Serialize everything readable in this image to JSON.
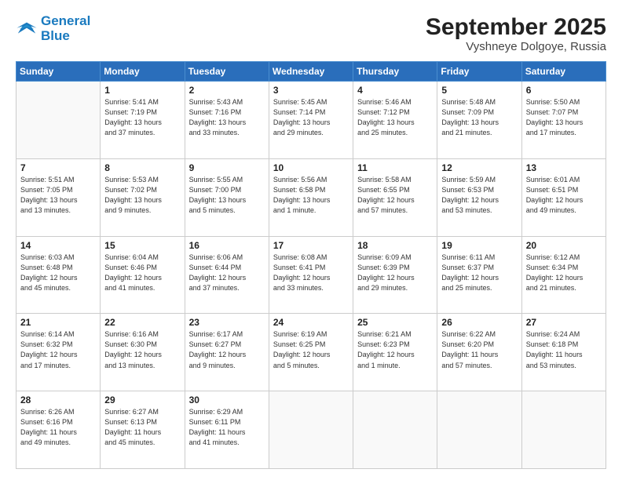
{
  "logo": {
    "line1": "General",
    "line2": "Blue"
  },
  "title": "September 2025",
  "location": "Vyshneye Dolgoye, Russia",
  "weekdays": [
    "Sunday",
    "Monday",
    "Tuesday",
    "Wednesday",
    "Thursday",
    "Friday",
    "Saturday"
  ],
  "weeks": [
    [
      {
        "day": "",
        "info": ""
      },
      {
        "day": "1",
        "info": "Sunrise: 5:41 AM\nSunset: 7:19 PM\nDaylight: 13 hours\nand 37 minutes."
      },
      {
        "day": "2",
        "info": "Sunrise: 5:43 AM\nSunset: 7:16 PM\nDaylight: 13 hours\nand 33 minutes."
      },
      {
        "day": "3",
        "info": "Sunrise: 5:45 AM\nSunset: 7:14 PM\nDaylight: 13 hours\nand 29 minutes."
      },
      {
        "day": "4",
        "info": "Sunrise: 5:46 AM\nSunset: 7:12 PM\nDaylight: 13 hours\nand 25 minutes."
      },
      {
        "day": "5",
        "info": "Sunrise: 5:48 AM\nSunset: 7:09 PM\nDaylight: 13 hours\nand 21 minutes."
      },
      {
        "day": "6",
        "info": "Sunrise: 5:50 AM\nSunset: 7:07 PM\nDaylight: 13 hours\nand 17 minutes."
      }
    ],
    [
      {
        "day": "7",
        "info": "Sunrise: 5:51 AM\nSunset: 7:05 PM\nDaylight: 13 hours\nand 13 minutes."
      },
      {
        "day": "8",
        "info": "Sunrise: 5:53 AM\nSunset: 7:02 PM\nDaylight: 13 hours\nand 9 minutes."
      },
      {
        "day": "9",
        "info": "Sunrise: 5:55 AM\nSunset: 7:00 PM\nDaylight: 13 hours\nand 5 minutes."
      },
      {
        "day": "10",
        "info": "Sunrise: 5:56 AM\nSunset: 6:58 PM\nDaylight: 13 hours\nand 1 minute."
      },
      {
        "day": "11",
        "info": "Sunrise: 5:58 AM\nSunset: 6:55 PM\nDaylight: 12 hours\nand 57 minutes."
      },
      {
        "day": "12",
        "info": "Sunrise: 5:59 AM\nSunset: 6:53 PM\nDaylight: 12 hours\nand 53 minutes."
      },
      {
        "day": "13",
        "info": "Sunrise: 6:01 AM\nSunset: 6:51 PM\nDaylight: 12 hours\nand 49 minutes."
      }
    ],
    [
      {
        "day": "14",
        "info": "Sunrise: 6:03 AM\nSunset: 6:48 PM\nDaylight: 12 hours\nand 45 minutes."
      },
      {
        "day": "15",
        "info": "Sunrise: 6:04 AM\nSunset: 6:46 PM\nDaylight: 12 hours\nand 41 minutes."
      },
      {
        "day": "16",
        "info": "Sunrise: 6:06 AM\nSunset: 6:44 PM\nDaylight: 12 hours\nand 37 minutes."
      },
      {
        "day": "17",
        "info": "Sunrise: 6:08 AM\nSunset: 6:41 PM\nDaylight: 12 hours\nand 33 minutes."
      },
      {
        "day": "18",
        "info": "Sunrise: 6:09 AM\nSunset: 6:39 PM\nDaylight: 12 hours\nand 29 minutes."
      },
      {
        "day": "19",
        "info": "Sunrise: 6:11 AM\nSunset: 6:37 PM\nDaylight: 12 hours\nand 25 minutes."
      },
      {
        "day": "20",
        "info": "Sunrise: 6:12 AM\nSunset: 6:34 PM\nDaylight: 12 hours\nand 21 minutes."
      }
    ],
    [
      {
        "day": "21",
        "info": "Sunrise: 6:14 AM\nSunset: 6:32 PM\nDaylight: 12 hours\nand 17 minutes."
      },
      {
        "day": "22",
        "info": "Sunrise: 6:16 AM\nSunset: 6:30 PM\nDaylight: 12 hours\nand 13 minutes."
      },
      {
        "day": "23",
        "info": "Sunrise: 6:17 AM\nSunset: 6:27 PM\nDaylight: 12 hours\nand 9 minutes."
      },
      {
        "day": "24",
        "info": "Sunrise: 6:19 AM\nSunset: 6:25 PM\nDaylight: 12 hours\nand 5 minutes."
      },
      {
        "day": "25",
        "info": "Sunrise: 6:21 AM\nSunset: 6:23 PM\nDaylight: 12 hours\nand 1 minute."
      },
      {
        "day": "26",
        "info": "Sunrise: 6:22 AM\nSunset: 6:20 PM\nDaylight: 11 hours\nand 57 minutes."
      },
      {
        "day": "27",
        "info": "Sunrise: 6:24 AM\nSunset: 6:18 PM\nDaylight: 11 hours\nand 53 minutes."
      }
    ],
    [
      {
        "day": "28",
        "info": "Sunrise: 6:26 AM\nSunset: 6:16 PM\nDaylight: 11 hours\nand 49 minutes."
      },
      {
        "day": "29",
        "info": "Sunrise: 6:27 AM\nSunset: 6:13 PM\nDaylight: 11 hours\nand 45 minutes."
      },
      {
        "day": "30",
        "info": "Sunrise: 6:29 AM\nSunset: 6:11 PM\nDaylight: 11 hours\nand 41 minutes."
      },
      {
        "day": "",
        "info": ""
      },
      {
        "day": "",
        "info": ""
      },
      {
        "day": "",
        "info": ""
      },
      {
        "day": "",
        "info": ""
      }
    ]
  ]
}
